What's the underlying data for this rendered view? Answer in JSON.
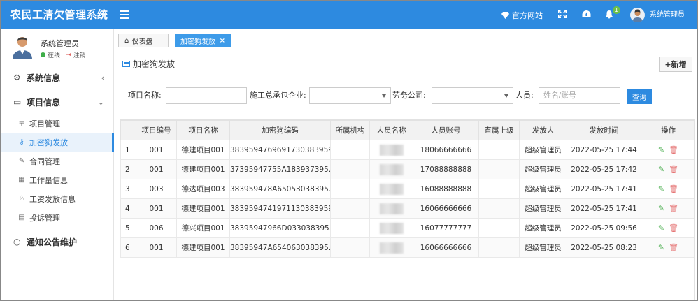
{
  "app": {
    "title": "农民工清欠管理系统"
  },
  "topbar": {
    "site_label": "官方网站",
    "notification_count": "1",
    "user_name": "系统管理员"
  },
  "sidebar": {
    "profile": {
      "name": "系统管理员",
      "status": "在线",
      "logout": "注销"
    },
    "groups": [
      {
        "label": "系统信息"
      },
      {
        "label": "项目信息"
      },
      {
        "label": "通知公告维护"
      }
    ],
    "items": [
      {
        "label": "项目管理"
      },
      {
        "label": "加密狗发放"
      },
      {
        "label": "合同管理"
      },
      {
        "label": "工作量信息"
      },
      {
        "label": "工资发放信息"
      },
      {
        "label": "投诉管理"
      }
    ]
  },
  "tabs": [
    {
      "label": "仪表盘"
    },
    {
      "label": "加密狗发放"
    }
  ],
  "page": {
    "title": "加密狗发放",
    "add_button": "新增"
  },
  "filters": {
    "project_name_label": "项目名称:",
    "contractor_label": "施工总承包企业:",
    "labor_label": "劳务公司:",
    "person_label": "人员:",
    "person_placeholder": "姓名/账号",
    "query_button": "查询"
  },
  "table": {
    "headers": [
      "",
      "项目编号",
      "项目名称",
      "加密狗编码",
      "所属机构",
      "人员名称",
      "人员账号",
      "直属上级",
      "发放人",
      "发放时间",
      "操作"
    ],
    "rows": [
      {
        "n": "1",
        "code": "001",
        "name": "德建项目001",
        "dongle": "383959476969173038395​9...",
        "org": "",
        "person": "",
        "account": "18066666666",
        "boss": "",
        "issuer": "超级管理员",
        "time": "2022-05-25 17:44"
      },
      {
        "n": "2",
        "code": "001",
        "name": "德建项目001",
        "dongle": "37395947755A183937395...",
        "org": "",
        "person": "",
        "account": "17088888888",
        "boss": "",
        "issuer": "超级管理员",
        "time": "2022-05-25 17:42"
      },
      {
        "n": "3",
        "code": "003",
        "name": "德达项目003",
        "dongle": "383959478A65053038395...",
        "org": "",
        "person": "",
        "account": "16088888888",
        "boss": "",
        "issuer": "超级管理员",
        "time": "2022-05-25 17:41"
      },
      {
        "n": "4",
        "code": "001",
        "name": "德建项目001",
        "dongle": "3839594741971130383959...",
        "org": "",
        "person": "",
        "account": "16066666666",
        "boss": "",
        "issuer": "超级管理员",
        "time": "2022-05-25 17:41"
      },
      {
        "n": "5",
        "code": "006",
        "name": "德兴项目001",
        "dongle": "38395947966D033038395...",
        "org": "",
        "person": "",
        "account": "16077777777",
        "boss": "",
        "issuer": "超级管理员",
        "time": "2022-05-25 09:56"
      },
      {
        "n": "6",
        "code": "001",
        "name": "德建项目001",
        "dongle": "38395947A654063038395...",
        "org": "",
        "person": "",
        "account": "16066666666",
        "boss": "",
        "issuer": "超级管理员",
        "time": "2022-05-25 08:23"
      }
    ]
  },
  "colors": {
    "primary": "#2d8ae0",
    "edit": "#4caf50",
    "delete": "#e57373"
  },
  "icons": {
    "edit": "pencil-icon",
    "delete": "trash-icon"
  }
}
